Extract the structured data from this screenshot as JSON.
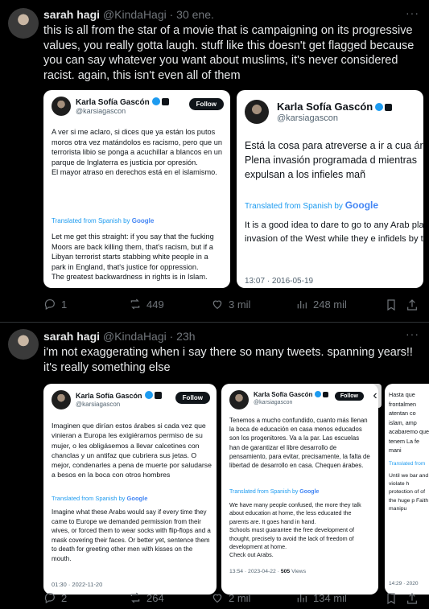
{
  "tweet1": {
    "name": "sarah hagi",
    "handle": "@KindaHagi",
    "time": "· 30 ene.",
    "text": "this is all from the star of a movie that is campaigning on its progressive values, you really gotta laugh. stuff like this doesn't get flagged because you can say whatever you want about muslims, it's never considered racist. again, this isn't even all of them",
    "card1": {
      "name": "Karla Sofía Gascón",
      "handle": "@karsiagascon",
      "follow": "Follow",
      "original": "A ver si me aclaro, si dices que ya están los putos moros otra vez matándolos es racismo, pero que un terrorista libio se ponga a acuchillar a blancos en un parque de Inglaterra es justicia por opresión.\nEl mayor atraso en derechos está en el islamismo.",
      "translated_prefix": "Translated from Spanish by",
      "google": "Google",
      "translation": "Let me get this straight: if you say that the fucking Moors are back killing them, that's racism, but if a Libyan terrorist starts stabbing white people in a park in England, that's justice for oppression.\nThe greatest backwardness in rights is in Islam."
    },
    "card2": {
      "name": "Karla Sofía Gascón",
      "handle": "@karsiagascon",
      "original": "Está la cosa para atreverse a ir a cua árabe. Plena invasión programada d mientras expulsan a los infieles mañ",
      "translated_prefix": "Translated from Spanish by",
      "google": "Google",
      "translation": "It is a good idea to dare to go to any Arab planned invasion of the West while they e infidels by trickery.",
      "timestamp": "13:07 · 2016-05-19"
    },
    "actions": {
      "replies": "1",
      "reposts": "449",
      "likes": "3 mil",
      "views": "248 mil"
    }
  },
  "tweet2": {
    "name": "sarah hagi",
    "handle": "@KindaHagi",
    "time": "· 23h",
    "text": "i'm not exaggerating when i say there so many tweets. spanning years!! it's really something else",
    "card1": {
      "name": "Karla Sofía Gascón",
      "handle": "@karsiagascon",
      "follow": "Follow",
      "original": "Imaginen que dirían estos árabes si cada vez que vinieran a Europa les exigiéramos permiso de su mujer, o les obligásemos a llevar calcetines con chanclas y un antifaz que cubriera sus jetas. O mejor, condenarles a pena de muerte por saludarse a besos en la boca con otros hombres",
      "translated_prefix": "Translated from Spanish by",
      "google": "Google",
      "translation": "Imagine what these Arabs would say if every time they came to Europe we demanded permission from their wives, or forced them to wear socks with flip-flops and a mask covering their faces. Or better yet, sentence them to death for greeting other men with kisses on the mouth.",
      "timestamp": "01:30 · 2022-11-20"
    },
    "card2": {
      "name": "Karla Sofía Gascón",
      "handle": "@karsiagascon",
      "follow": "Follow",
      "original": "Tenemos a mucho confundido, cuanto más llenan la boca de educación en casa menos educados son los progenitores. Va a la par. Las escuelas han de garantizar el libre desarrollo de pensamiento, para evitar, precisamente, la falta de libertad de desarrollo en casa. Chequen árabes.",
      "translated_prefix": "Translated from Spanish by",
      "google": "Google",
      "translation": "We have many people confused, the more they talk about education at home, the less educated the parents are. It goes hand in hand.\nSchools must guarantee the free development of thought, precisely to avoid the lack of freedom of development at home.\nCheck out Arabs.",
      "timestamp": "13:54 · 2023-04-22 ·",
      "views": "505",
      "views_label": "Views"
    },
    "card3": {
      "original": "Hasta que frontalmen atentan co islam, amp acabaremo que tenem La fe mani",
      "translated_prefix": "Translated from",
      "translation": "Until we bar and violate h protection of of the huge p Faith manipu",
      "timestamp": "14:29 · 2020"
    },
    "actions": {
      "replies": "2",
      "reposts": "264",
      "likes": "2 mil",
      "views": "134 mil"
    }
  }
}
